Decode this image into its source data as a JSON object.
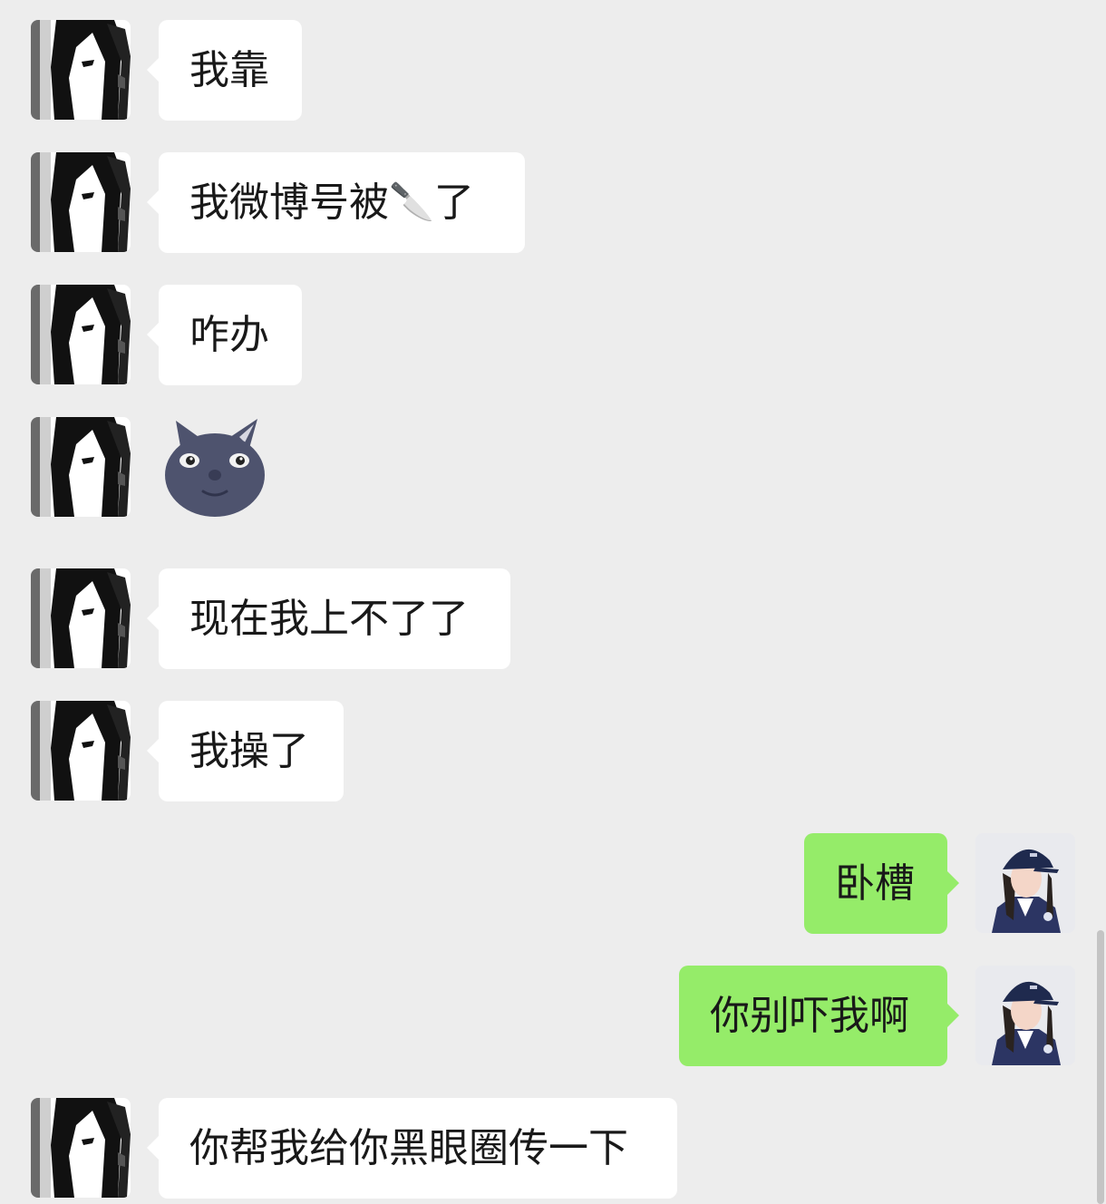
{
  "colors": {
    "background": "#ededed",
    "incoming_bubble": "#ffffff",
    "outgoing_bubble": "#95ec69"
  },
  "messages": [
    {
      "side": "in",
      "text": "我靠"
    },
    {
      "side": "in",
      "text_before": "我微博号被",
      "emoji": "🔪",
      "emoji_name": "knife-emoji",
      "text_after": "了"
    },
    {
      "side": "in",
      "text": "咋办"
    },
    {
      "side": "in",
      "type": "sticker",
      "sticker_name": "dark-cat-face-sticker"
    },
    {
      "side": "in",
      "text": "现在我上不了了"
    },
    {
      "side": "in",
      "text": "我操了"
    },
    {
      "side": "out",
      "text": "卧槽"
    },
    {
      "side": "out",
      "text": "你别吓我啊"
    },
    {
      "side": "in",
      "text": "你帮我给你黑眼圈传一下"
    }
  ]
}
